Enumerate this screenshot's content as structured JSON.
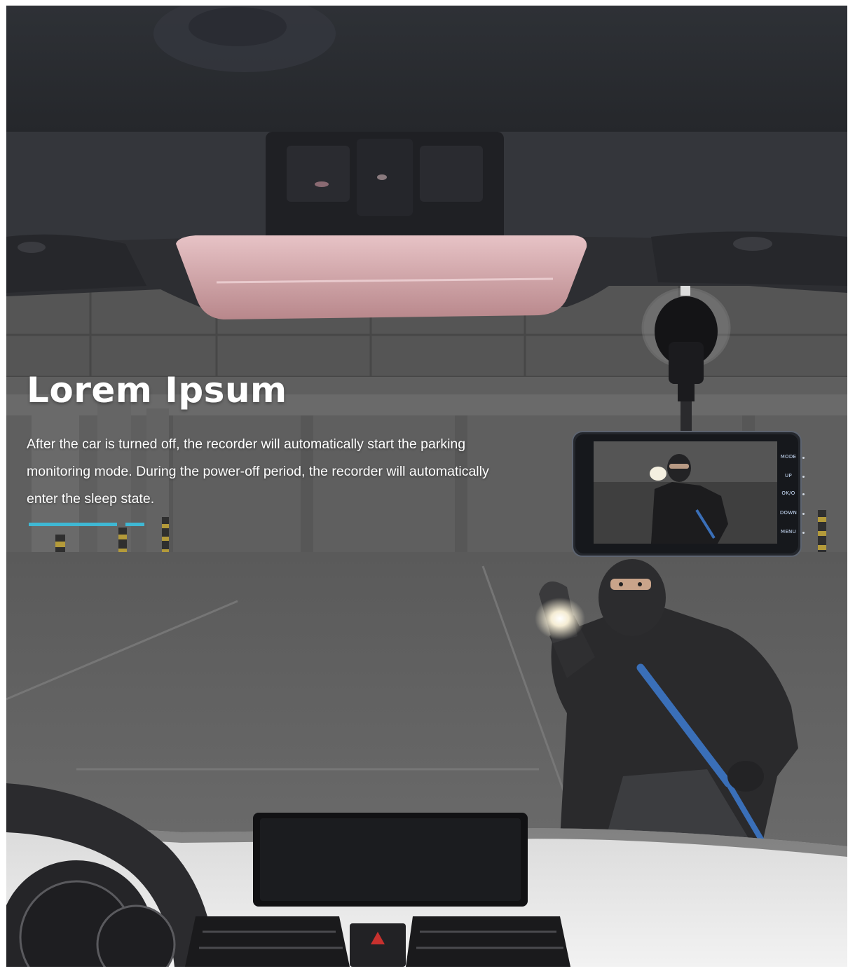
{
  "hero": {
    "title": "Lorem Ipsum",
    "description": "After the car is turned off, the recorder will automatically start the parking monitoring mode. During the power-off period, the recorder will automatically enter the sleep state."
  },
  "dashcam": {
    "buttons": [
      "MODE",
      "UP",
      "OK/O",
      "DOWN",
      "MENU"
    ]
  },
  "colors": {
    "accent": "#3fb8d4",
    "crowbar": "#3a6fb8"
  }
}
